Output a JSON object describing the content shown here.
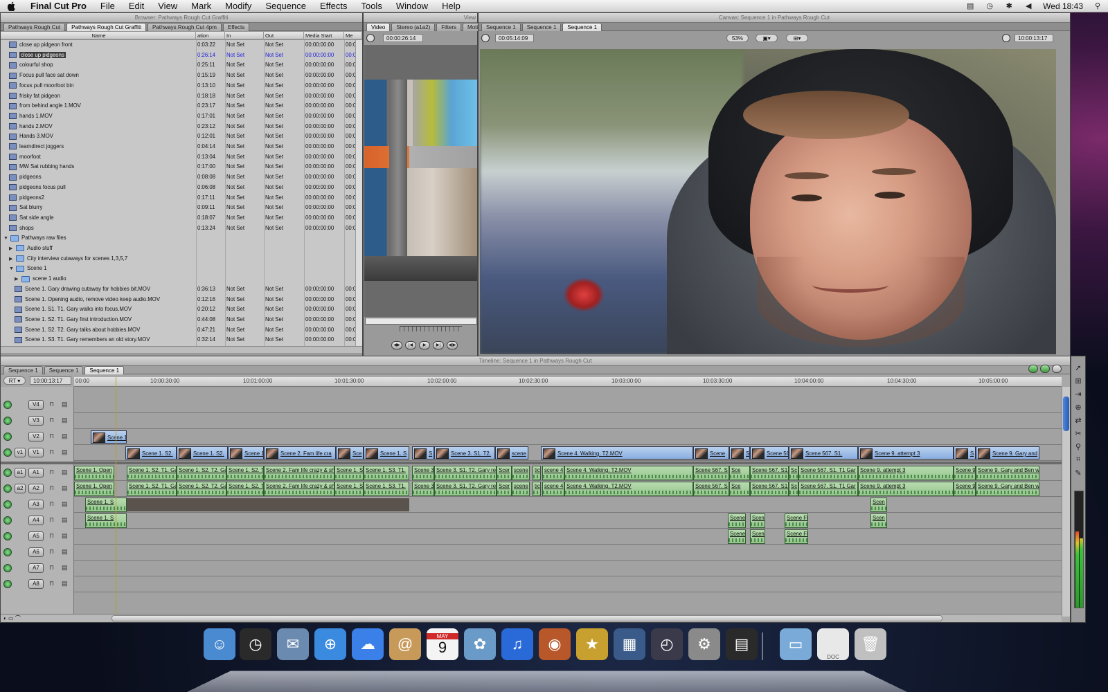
{
  "menubar": {
    "app": "Final Cut Pro",
    "items": [
      "File",
      "Edit",
      "View",
      "Mark",
      "Modify",
      "Sequence",
      "Effects",
      "Tools",
      "Window",
      "Help"
    ],
    "clock": "Wed 18:43"
  },
  "browser": {
    "title": "Browser: Pathways Rough Cut Graffiti",
    "tabs": [
      "Pathways Rough Cut",
      "Pathways Rough Cut Graffiti",
      "Pathways Rough Cut 4pm",
      "Effects"
    ],
    "active_tab": 1,
    "columns": [
      "Name",
      "ation",
      "In",
      "Out",
      "Media Start",
      "Me"
    ],
    "rows": [
      {
        "name": "close up pidgeon front",
        "dur": "0:03:22",
        "in": "Not Set",
        "out": "Not Set",
        "ms": "00:00:00:00",
        "me": "00:0",
        "kind": "clip",
        "indent": 0
      },
      {
        "name": "close up pidgeons",
        "dur": "0:26:14",
        "in": "Not Set",
        "out": "Not Set",
        "ms": "00:00:00:00",
        "me": "00:0",
        "kind": "clip",
        "indent": 0,
        "selected": true
      },
      {
        "name": "colourful shop",
        "dur": "0:25:11",
        "in": "Not Set",
        "out": "Not Set",
        "ms": "00:00:00:00",
        "me": "00:0",
        "kind": "clip",
        "indent": 0
      },
      {
        "name": "Focus pull face sat down",
        "dur": "0:15:19",
        "in": "Not Set",
        "out": "Not Set",
        "ms": "00:00:00:00",
        "me": "00:0",
        "kind": "clip",
        "indent": 0
      },
      {
        "name": "focus pull moorfoot bin",
        "dur": "0:13:10",
        "in": "Not Set",
        "out": "Not Set",
        "ms": "00:00:00:00",
        "me": "00:0",
        "kind": "clip",
        "indent": 0
      },
      {
        "name": "frisky fat pidgeon",
        "dur": "0:18:18",
        "in": "Not Set",
        "out": "Not Set",
        "ms": "00:00:00:00",
        "me": "00:0",
        "kind": "clip",
        "indent": 0
      },
      {
        "name": "from behind angle 1.MOV",
        "dur": "0:23:17",
        "in": "Not Set",
        "out": "Not Set",
        "ms": "00:00:00:00",
        "me": "00:0",
        "kind": "clip",
        "indent": 0
      },
      {
        "name": "hands 1.MOV",
        "dur": "0:17:01",
        "in": "Not Set",
        "out": "Not Set",
        "ms": "00:00:00:00",
        "me": "00:0",
        "kind": "clip",
        "indent": 0
      },
      {
        "name": "hands 2.MOV",
        "dur": "0:23:12",
        "in": "Not Set",
        "out": "Not Set",
        "ms": "00:00:00:00",
        "me": "00:0",
        "kind": "clip",
        "indent": 0
      },
      {
        "name": "Hands 3.MOV",
        "dur": "0:12:01",
        "in": "Not Set",
        "out": "Not Set",
        "ms": "00:00:00:00",
        "me": "00:0",
        "kind": "clip",
        "indent": 0
      },
      {
        "name": "learndirect joggers",
        "dur": "0:04:14",
        "in": "Not Set",
        "out": "Not Set",
        "ms": "00:00:00:00",
        "me": "00:0",
        "kind": "clip",
        "indent": 0
      },
      {
        "name": "moorfoot",
        "dur": "0:13:04",
        "in": "Not Set",
        "out": "Not Set",
        "ms": "00:00:00:00",
        "me": "00:0",
        "kind": "clip",
        "indent": 0
      },
      {
        "name": "MW Sat rubbing hands",
        "dur": "0:17:00",
        "in": "Not Set",
        "out": "Not Set",
        "ms": "00:00:00:00",
        "me": "00:0",
        "kind": "clip",
        "indent": 0
      },
      {
        "name": "pidgeons",
        "dur": "0:08:08",
        "in": "Not Set",
        "out": "Not Set",
        "ms": "00:00:00:00",
        "me": "00:0",
        "kind": "clip",
        "indent": 0
      },
      {
        "name": "pidgeons focus pull",
        "dur": "0:06:08",
        "in": "Not Set",
        "out": "Not Set",
        "ms": "00:00:00:00",
        "me": "00:0",
        "kind": "clip",
        "indent": 0
      },
      {
        "name": "pidgeons2",
        "dur": "0:17:11",
        "in": "Not Set",
        "out": "Not Set",
        "ms": "00:00:00:00",
        "me": "00:0",
        "kind": "clip",
        "indent": 0
      },
      {
        "name": "Sat blurry",
        "dur": "0:09:11",
        "in": "Not Set",
        "out": "Not Set",
        "ms": "00:00:00:00",
        "me": "00:0",
        "kind": "clip",
        "indent": 0
      },
      {
        "name": "Sat side angle",
        "dur": "0:18:07",
        "in": "Not Set",
        "out": "Not Set",
        "ms": "00:00:00:00",
        "me": "00:0",
        "kind": "clip",
        "indent": 0
      },
      {
        "name": "shops",
        "dur": "0:13:24",
        "in": "Not Set",
        "out": "Not Set",
        "ms": "00:00:00:00",
        "me": "00:0",
        "kind": "clip",
        "indent": 0
      },
      {
        "name": "Pathways raw files",
        "dur": "",
        "in": "",
        "out": "",
        "ms": "",
        "me": "",
        "kind": "folder-open",
        "indent": -1
      },
      {
        "name": "Audio stuff",
        "dur": "",
        "in": "",
        "out": "",
        "ms": "",
        "me": "",
        "kind": "folder",
        "indent": 0
      },
      {
        "name": "City interview cutaways for scenes 1,3,5,7",
        "dur": "",
        "in": "",
        "out": "",
        "ms": "",
        "me": "",
        "kind": "folder",
        "indent": 0
      },
      {
        "name": "Scene 1",
        "dur": "",
        "in": "",
        "out": "",
        "ms": "",
        "me": "",
        "kind": "folder-open",
        "indent": 0
      },
      {
        "name": "scene 1 audio",
        "dur": "",
        "in": "",
        "out": "",
        "ms": "",
        "me": "",
        "kind": "folder",
        "indent": 1
      },
      {
        "name": "Scene 1. Gary drawing cutaway for hobbies bit.MOV",
        "dur": "0:36:13",
        "in": "Not Set",
        "out": "Not Set",
        "ms": "00:00:00:00",
        "me": "00:0",
        "kind": "clip",
        "indent": 1
      },
      {
        "name": "Scene 1. Opening audio, remove video keep audio.MOV",
        "dur": "0:12:16",
        "in": "Not Set",
        "out": "Not Set",
        "ms": "00:00:00:00",
        "me": "00:0",
        "kind": "clip",
        "indent": 1
      },
      {
        "name": "Scene 1. S1. T1. Gary walks into focus.MOV",
        "dur": "0:20:12",
        "in": "Not Set",
        "out": "Not Set",
        "ms": "00:00:00:00",
        "me": "00:0",
        "kind": "clip",
        "indent": 1
      },
      {
        "name": "Scene 1. S2. T1. Gary first introduction.MOV",
        "dur": "0:44:08",
        "in": "Not Set",
        "out": "Not Set",
        "ms": "00:00:00:00",
        "me": "00:0",
        "kind": "clip",
        "indent": 1
      },
      {
        "name": "Scene 1. S2. T2. Gary talks about hobbies.MOV",
        "dur": "0:47:21",
        "in": "Not Set",
        "out": "Not Set",
        "ms": "00:00:00:00",
        "me": "00:0",
        "kind": "clip",
        "indent": 1
      },
      {
        "name": "Scene 1. S3. T1. Gary remembers an old story.MOV",
        "dur": "0:32:14",
        "in": "Not Set",
        "out": "Not Set",
        "ms": "00:00:00:00",
        "me": "00:0",
        "kind": "clip",
        "indent": 1
      }
    ]
  },
  "viewer": {
    "title": "View",
    "tabs": [
      "Video",
      "Stereo (a1a2)",
      "Filters",
      "Motion"
    ],
    "duration": "00:00:26:14"
  },
  "canvas": {
    "title": "Canvas: Sequence 1 in Pathways Rough Cut",
    "tabs": [
      "Sequence 1",
      "Sequence 1",
      "Sequence 1"
    ],
    "duration": "00:05:14:09",
    "zoom": "53%",
    "timecode": "10:00:13:17"
  },
  "timeline": {
    "title": "Timeline: Sequence 1 in Pathways Rough Cut",
    "tabs": [
      "Sequence 1",
      "Sequence 1",
      "Sequence 1"
    ],
    "rt": "RT",
    "timecode": "10:00:13:17",
    "ruler": [
      "00:00",
      "10:00:30:00",
      "10:01:00:00",
      "10:01:30:00",
      "10:02:00:00",
      "10:02:30:00",
      "10:03:00:00",
      "10:03:30:00",
      "10:04:00:00",
      "10:04:30:00",
      "10:05:00:00"
    ],
    "video_tracks": [
      "V4",
      "V3",
      "V2",
      "V1"
    ],
    "audio_tracks": [
      "A1",
      "A2",
      "A3",
      "A4",
      "A5",
      "A6",
      "A7",
      "A8"
    ],
    "src_v": "v1",
    "src_a": [
      "a1",
      "a2"
    ],
    "v2_clips": [
      "Scene 1"
    ],
    "v1_clips": [
      "Scene 1. S2.",
      "Scene 1. S2.",
      "Scene 1",
      "Scene 2. Fam life cra",
      "Sce",
      "Scene 1. S",
      "S",
      "Scene 3. S1. T2.",
      "scene",
      "Scene 4. Walking. T2.MOV",
      "Scene",
      "S",
      "Scene 56",
      "Scene 567. S1.",
      "Scene 9. attempt 3",
      "S",
      "Scene 9. Gary and"
    ],
    "a1_clips": [
      "Scene 1. Open",
      "Scene 1. S2. T1. Ga",
      "Scene 1. S2. T2. Ga",
      "Scene 1. S2. T",
      "Scene 2. Fam life crazy & sh",
      "Scene 1. S",
      "Scene 1. S3. T1.",
      "Scene 3",
      "Scene 3. S1. T2. Gary re",
      "Scer",
      "scene",
      "tic",
      "scene 4",
      "Scene 4. Walking. T2.MOV",
      "Scene 567. S",
      "Sce",
      "Scene 567. S1.",
      "Sc",
      "Scene 567. S1. T1 Gar",
      "Scene 9. attempt 3",
      "Scene 9",
      "Scene 9. Gary and Ben w"
    ],
    "a3_clips": [
      "Scene 1. S",
      "Scen"
    ],
    "a4_clips": [
      "Scene 1. S",
      "Scene",
      "Scen",
      "Scene Fl",
      "Scen"
    ],
    "a5_clips": [
      "Scene",
      "Scen",
      "Scene Fl"
    ]
  },
  "dock": {
    "items": [
      "finder-icon",
      "dashboard-icon",
      "mail-icon",
      "safari-icon",
      "ichat-icon",
      "address-book-icon",
      "ical-icon",
      "iphoto-icon",
      "itunes-icon",
      "photo-booth-icon",
      "imovie-icon",
      "spaces-icon",
      "time-machine-icon",
      "system-preferences-icon",
      "final-cut-icon",
      "downloads-folder-icon",
      "document-icon",
      "trash-icon"
    ],
    "ical_month": "MAY",
    "ical_day": "9",
    "doc_label": "DOC"
  }
}
